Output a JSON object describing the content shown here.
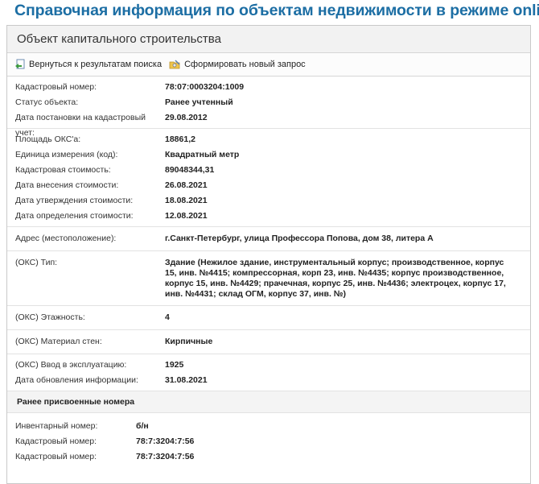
{
  "page": {
    "title": "Справочная информация по объектам недвижимости в режиме online"
  },
  "panel": {
    "title": "Объект капитального строительства"
  },
  "toolbar": {
    "back_label": "Вернуться к результатам поиска",
    "new_request_label": "Сформировать новый запрос"
  },
  "sections": [
    [
      {
        "label": "Кадастровый номер:",
        "value": "78:07:0003204:1009"
      },
      {
        "label": "Статус объекта:",
        "value": "Ранее учтенный"
      },
      {
        "label": "Дата постановки на кадастровый учет:",
        "value": "29.08.2012"
      }
    ],
    [
      {
        "label": "Площадь ОКС'a:",
        "value": "18861,2"
      },
      {
        "label": "Единица измерения (код):",
        "value": "Квадратный метр"
      },
      {
        "label": "Кадастровая стоимость:",
        "value": "89048344,31"
      },
      {
        "label": "Дата внесения стоимости:",
        "value": "26.08.2021"
      },
      {
        "label": "Дата утверждения стоимости:",
        "value": "18.08.2021"
      },
      {
        "label": "Дата определения стоимости:",
        "value": "12.08.2021"
      }
    ],
    [
      {
        "label": "Адрес (местоположение):",
        "value": "г.Санкт-Петербург, улица Профессора Попова, дом 38, литера А"
      }
    ],
    [
      {
        "label": "(ОКС) Тип:",
        "value": "Здание (Нежилое здание, инструментальный корпус; производственное, корпус 15, инв. №4415; компрессорная, корп 23, инв. №4435; корпус производственное, корпус 15, инв. №4429; прачечная, корпус 25, инв. №4436; электроцех, корпус 17, инв. №4431; склад ОГМ, корпус 37, инв. №)"
      }
    ],
    [
      {
        "label": "(ОКС) Этажность:",
        "value": "4"
      }
    ],
    [
      {
        "label": "(ОКС) Материал стен:",
        "value": "Кирпичные"
      }
    ],
    [
      {
        "label": "(ОКС) Ввод в эксплуатацию:",
        "value": "1925"
      },
      {
        "label": "Дата обновления информации:",
        "value": "31.08.2021"
      }
    ]
  ],
  "previous": {
    "title": "Ранее присвоенные номера",
    "rows": [
      {
        "label": "Инвентарный номер:",
        "value": "б/н"
      },
      {
        "label": "Кадастровый номер:",
        "value": "78:7:3204:7:56"
      },
      {
        "label": "Кадастровый номер:",
        "value": "78:7:3204:7:56"
      }
    ]
  }
}
